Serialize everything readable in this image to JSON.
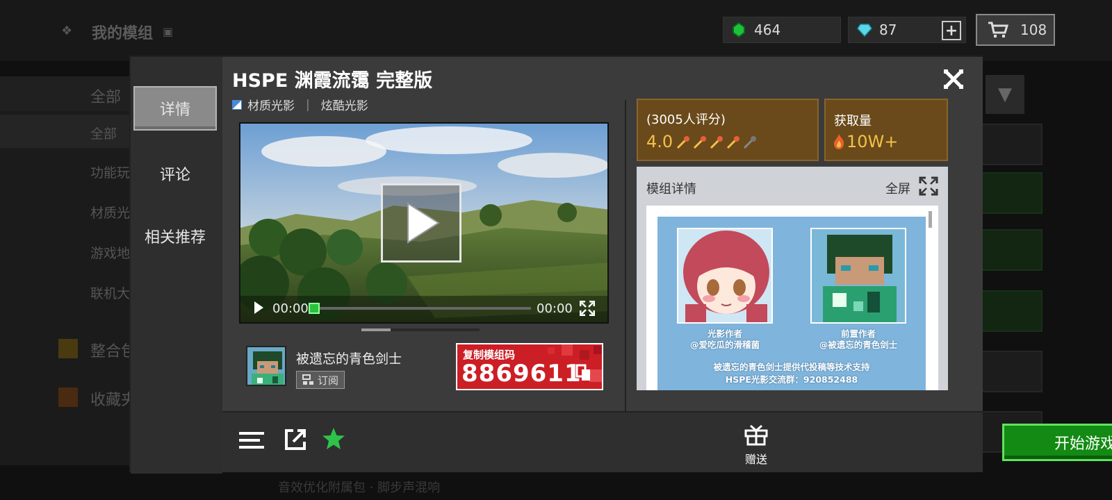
{
  "background_page": {
    "title": "我的模组",
    "categories": [
      "全部",
      "全部",
      "功能玩",
      "材质光",
      "游戏地",
      "联机大"
    ],
    "sections": [
      "整合包",
      "收藏夹"
    ],
    "bottom_text": "音效优化附属包 · 脚步声混响"
  },
  "currency": {
    "emerald": "464",
    "diamond": "87",
    "cart": "108"
  },
  "modal": {
    "tabs": [
      "详情",
      "评论",
      "相关推荐"
    ],
    "title": "HSPE 渊霞流霭 完整版",
    "tags": [
      "材质光影",
      "炫酷光影"
    ],
    "tag_separator": "|",
    "video": {
      "time_current": "00:00",
      "time_total": "00:00",
      "progress": 0
    },
    "author": {
      "name": "被遗忘的青色剑士",
      "subscribe_label": "订阅"
    },
    "copy_code": {
      "label": "复制模组码",
      "code": "8869611"
    },
    "rating": {
      "count_label": "(3005人评分)",
      "score": "4.0",
      "stars_filled": 4,
      "stars_total": 5
    },
    "downloads": {
      "label": "获取量",
      "value": "10W+"
    },
    "details": {
      "header": "模组详情",
      "fullscreen_label": "全屏",
      "image_caption_left_1": "光影作者",
      "image_caption_left_2": "@爱吃瓜的滑稽菌",
      "image_caption_right_1": "前置作者",
      "image_caption_right_2": "@被遗忘的青色剑士",
      "image_line_1": "被遗忘的青色剑士提供代投稿等技术支持",
      "image_line_2": "HSPE光影交流群：920852488"
    },
    "footer": {
      "gift_label": "赠送",
      "play_label": "开始游戏"
    }
  },
  "colors": {
    "accent_green": "#1a8a1a",
    "copy_red": "#cc1e25",
    "stat_brown": "#6a4a1a",
    "rating_text": "#f2c14a"
  }
}
